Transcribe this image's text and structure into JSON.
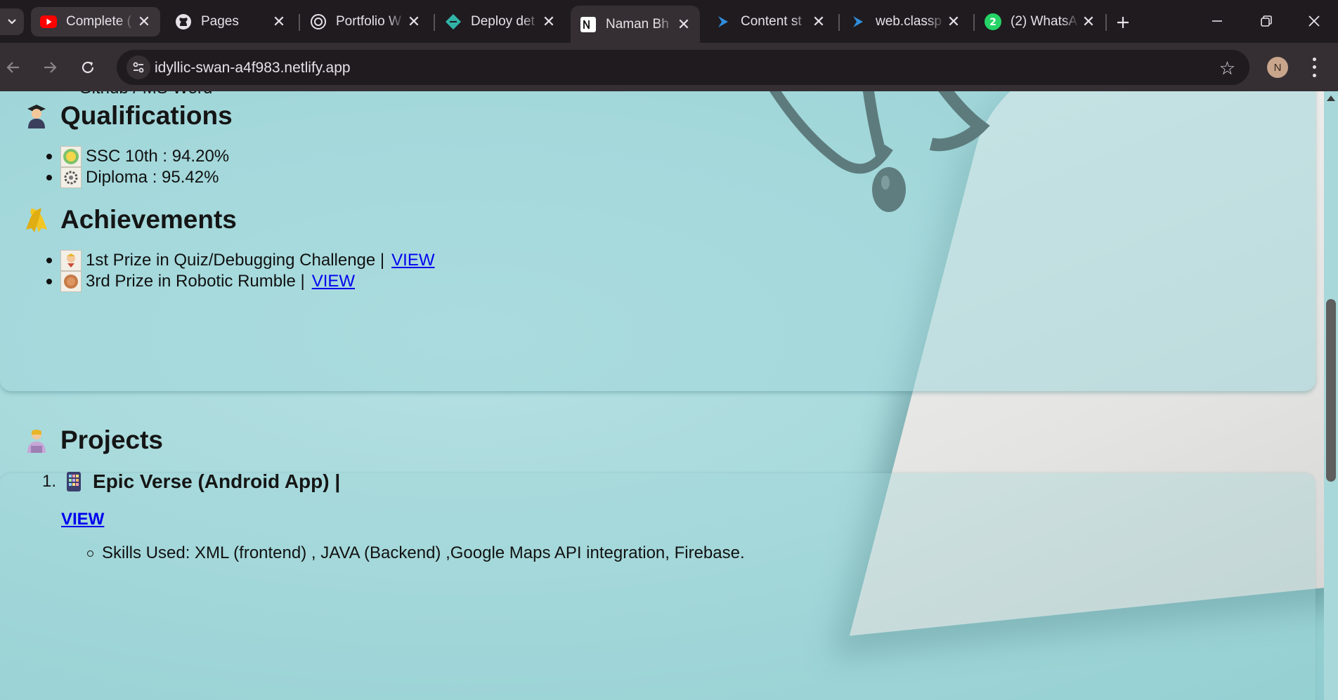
{
  "browser": {
    "tabs": [
      {
        "title": "Complete (",
        "favicon": "youtube-icon"
      },
      {
        "title": "Pages",
        "favicon": "github-icon"
      },
      {
        "title": "Portfolio W",
        "favicon": "openai-icon"
      },
      {
        "title": "Deploy det",
        "favicon": "netlify-icon"
      },
      {
        "title": "Naman Bh",
        "favicon": "notion-icon",
        "active": true
      },
      {
        "title": "Content st",
        "favicon": "classplus-icon"
      },
      {
        "title": "web.classp",
        "favicon": "classplus-icon"
      },
      {
        "title": "(2) WhatsA",
        "favicon": "whatsapp-icon",
        "badge": "2"
      }
    ],
    "address": {
      "url": "idyllic-swan-a4f983.netlify.app"
    },
    "profile_initial": "N"
  },
  "page": {
    "cut_item": "Github / MS Word",
    "qualifications": {
      "heading": "Qualifications",
      "items": [
        {
          "text": "SSC 10th : 94.20%"
        },
        {
          "text": "Diploma : 95.42%"
        }
      ]
    },
    "achievements": {
      "heading": "Achievements",
      "items": [
        {
          "text": "1st Prize in Quiz/Debugging Challenge |",
          "link": "VIEW"
        },
        {
          "text": "3rd Prize in Robotic Rumble |",
          "link": "VIEW"
        }
      ]
    },
    "projects": {
      "heading": "Projects",
      "items": [
        {
          "number": "1.",
          "title": "Epic Verse (Android App) |",
          "link": "VIEW",
          "skills": "Skills Used: XML (frontend) , JAVA (Backend) ,Google Maps API integration, Firebase."
        }
      ]
    }
  },
  "colors": {
    "browser_bg": "#1f1b1f",
    "toolbar_bg": "#352f33",
    "page_bg": "#a7d9db",
    "link": "#0000ee"
  }
}
